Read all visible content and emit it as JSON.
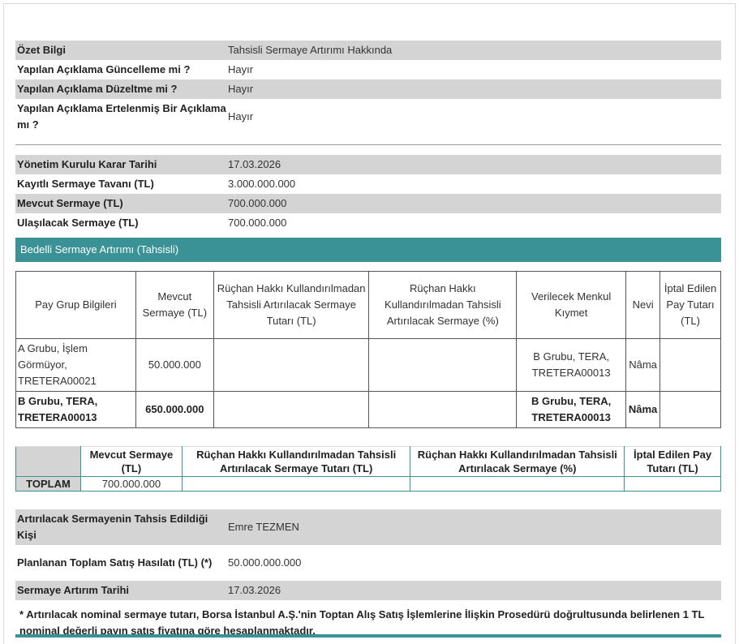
{
  "summary": [
    {
      "key": "Özet Bilgi",
      "value": "Tahsisli Sermaye Artırımı Hakkında"
    },
    {
      "key": "Yapılan Açıklama Güncelleme mi ?",
      "value": "Hayır"
    },
    {
      "key": "Yapılan Açıklama Düzeltme mi ?",
      "value": "Hayır"
    },
    {
      "key": "Yapılan Açıklama Ertelenmiş Bir Açıklama mı ?",
      "value": "Hayır"
    }
  ],
  "capital": [
    {
      "key": "Yönetim Kurulu Karar Tarihi",
      "value": "17.03.2026"
    },
    {
      "key": "Kayıtlı Sermaye Tavanı (TL)",
      "value": "3.000.000.000"
    },
    {
      "key": "Mevcut Sermaye (TL)",
      "value": "700.000.000"
    },
    {
      "key": "Ulaşılacak Sermaye (TL)",
      "value": "700.000.000"
    }
  ],
  "section_title": "Bedelli Sermaye Artırımı (Tahsisli)",
  "group_table": {
    "headers": [
      "Pay Grup Bilgileri",
      "Mevcut Sermaye (TL)",
      "Rüçhan Hakkı Kullandırılmadan Tahsisli Artırılacak Sermaye Tutarı (TL)",
      "Rüçhan Hakkı Kullandırılmadan Tahsisli Artırılacak Sermaye (%)",
      "Verilecek Menkul Kıymet",
      "Nevi",
      "İptal Edilen Pay Tutarı (TL)"
    ],
    "rows": [
      [
        "A Grubu, İşlem Görmüyor, TRETERA00021",
        "50.000.000",
        "",
        "",
        "B Grubu, TERA, TRETERA00013",
        "Nâma",
        ""
      ],
      [
        "B Grubu, TERA, TRETERA00013",
        "650.000.000",
        "",
        "",
        "B Grubu, TERA, TRETERA00013",
        "Nâma",
        ""
      ]
    ]
  },
  "total_table": {
    "headers": [
      "",
      "Mevcut Sermaye (TL)",
      "Rüçhan Hakkı Kullandırılmadan Tahsisli Artırılacak Sermaye Tutarı (TL)",
      "Rüçhan Hakkı Kullandırılmadan Tahsisli Artırılacak Sermaye (%)",
      "İptal Edilen Pay Tutarı (TL)"
    ],
    "row": [
      "TOPLAM",
      "700.000.000",
      "",
      "",
      ""
    ]
  },
  "allocation": [
    {
      "key": "Artırılacak Sermayenin Tahsis Edildiği Kişi",
      "value": "Emre TEZMEN"
    },
    {
      "key": "Planlanan Toplam Satış Hasılatı (TL) (*)",
      "value": "50.000.000.000"
    },
    {
      "key": "Sermaye Artırım Tarihi",
      "value": "17.03.2026"
    }
  ],
  "footnote": "* Artırılacak nominal sermaye tutarı, Borsa İstanbul A.Ş.'nin Toptan Alış Satış İşlemlerine İlişkin Prosedürü doğrultusunda belirlenen 1 TL nominal değerli payın satış fiyatına göre hesaplanmaktadır."
}
